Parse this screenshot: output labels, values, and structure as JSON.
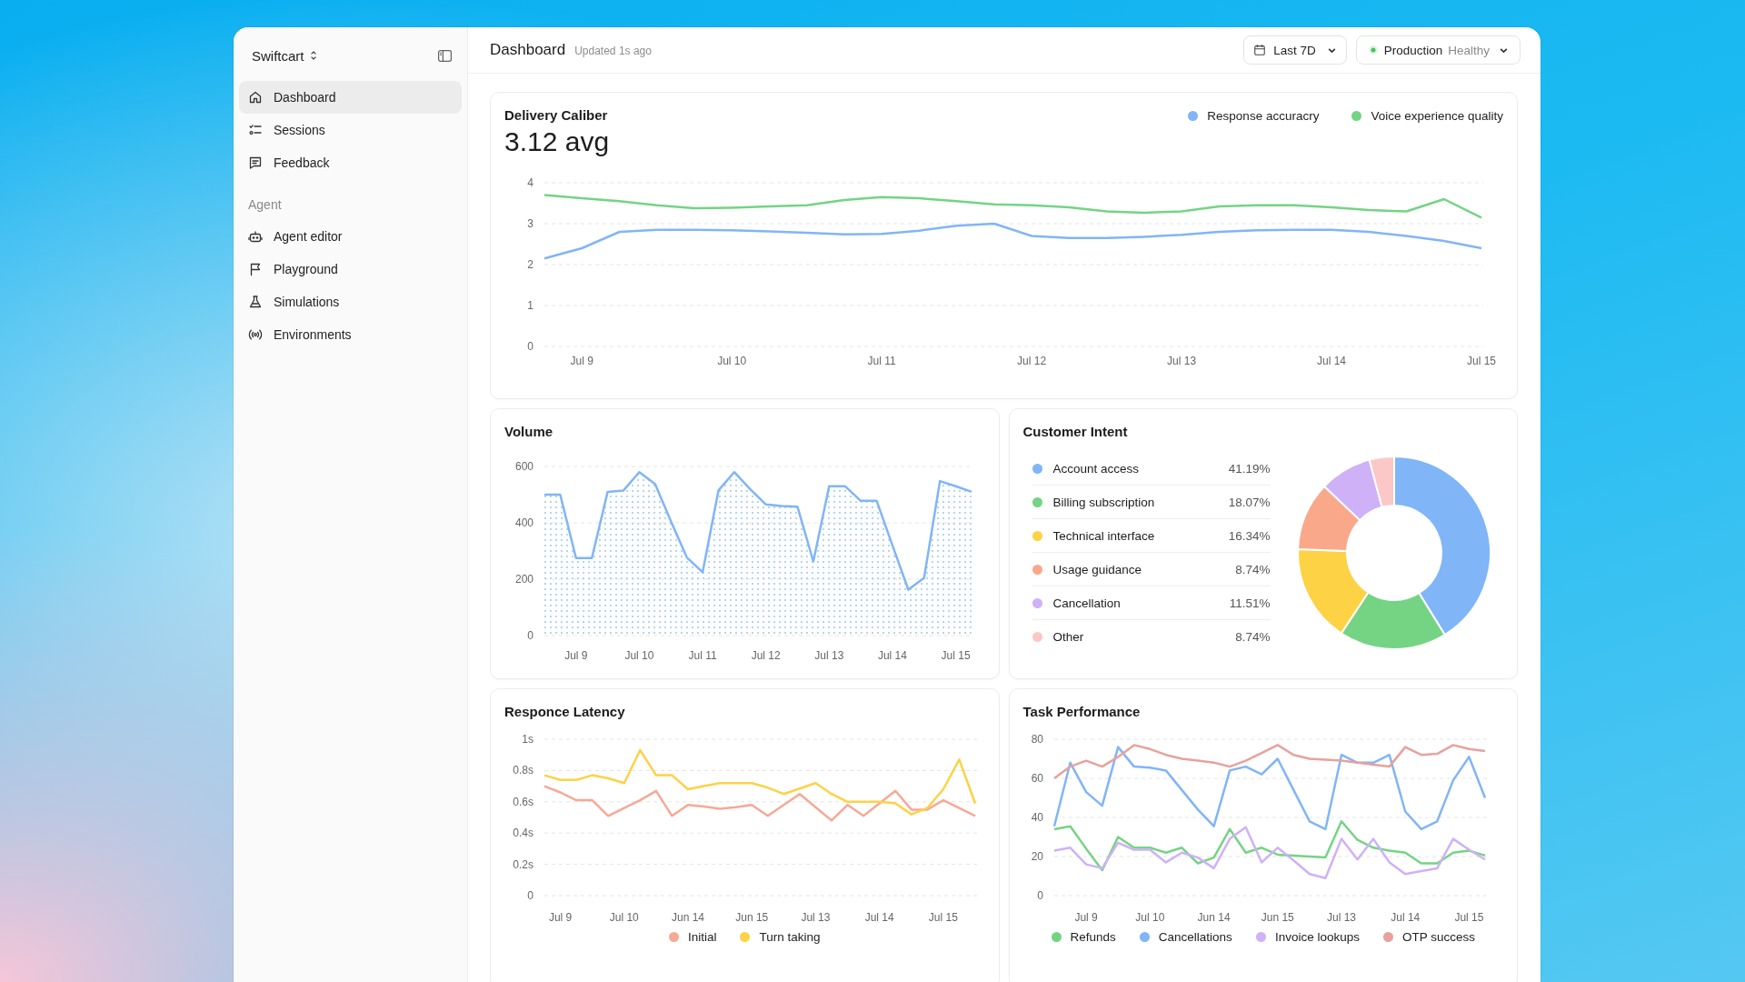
{
  "sidebar": {
    "workspace": "Swiftcart",
    "nav": [
      {
        "label": "Dashboard",
        "selected": true
      },
      {
        "label": "Sessions",
        "selected": false
      },
      {
        "label": "Feedback",
        "selected": false
      }
    ],
    "section_label": "Agent",
    "agent_nav": [
      {
        "label": "Agent editor",
        "selected": false
      },
      {
        "label": "Playground",
        "selected": false
      },
      {
        "label": "Simulations",
        "selected": false
      },
      {
        "label": "Environments",
        "selected": false
      }
    ]
  },
  "header": {
    "title": "Dashboard",
    "updated": "Updated 1s ago",
    "range": "Last 7D",
    "environment": "Production",
    "environment_status": "Healthy"
  },
  "delivery_caliber": {
    "title": "Delivery Caliber",
    "value": "3.12 avg",
    "chart_data": {
      "type": "line",
      "grid": true,
      "categories": [
        null,
        "Jul 9",
        null,
        null,
        null,
        "Jul 10",
        null,
        null,
        null,
        "Jul 11",
        null,
        null,
        null,
        "Jul 12",
        null,
        null,
        null,
        "Jul 13",
        null,
        null,
        null,
        "Jul 14",
        null,
        null,
        null,
        "Jul 15"
      ],
      "ylim": [
        0,
        4
      ],
      "yticks": [
        0,
        1,
        2,
        3,
        4
      ],
      "series": [
        {
          "name": "Response accuracry",
          "color": "#80b5f8",
          "values": [
            2.15,
            2.4,
            2.8,
            2.85,
            2.85,
            2.84,
            2.81,
            2.78,
            2.74,
            2.75,
            2.83,
            2.95,
            3.0,
            2.7,
            2.65,
            2.65,
            2.68,
            2.73,
            2.8,
            2.84,
            2.85,
            2.85,
            2.8,
            2.7,
            2.58,
            2.4
          ]
        },
        {
          "name": "Voice experience quality",
          "color": "#74d484",
          "values": [
            3.7,
            3.62,
            3.55,
            3.45,
            3.38,
            3.39,
            3.42,
            3.45,
            3.58,
            3.65,
            3.62,
            3.55,
            3.47,
            3.45,
            3.4,
            3.3,
            3.27,
            3.3,
            3.42,
            3.45,
            3.45,
            3.4,
            3.33,
            3.3,
            3.6,
            3.15
          ]
        }
      ]
    }
  },
  "volume": {
    "title": "Volume",
    "chart_data": {
      "type": "area",
      "grid": true,
      "categories": [
        null,
        null,
        "Jul 9",
        null,
        null,
        null,
        "Jul 10",
        null,
        null,
        null,
        "Jul 11",
        null,
        null,
        null,
        "Jul 12",
        null,
        null,
        null,
        "Jul 13",
        null,
        null,
        null,
        "Jul 14",
        null,
        null,
        null,
        "Jul 15",
        null
      ],
      "ylim": [
        0,
        600
      ],
      "yticks": [
        0,
        200,
        400,
        600
      ],
      "series": [
        {
          "color": "#80b5f8",
          "values": [
            500,
            500,
            275,
            275,
            510,
            515,
            580,
            537,
            405,
            277,
            225,
            515,
            580,
            520,
            465,
            460,
            457,
            263,
            530,
            530,
            478,
            478,
            320,
            163,
            205,
            548,
            530,
            510
          ]
        }
      ]
    }
  },
  "customer_intent": {
    "title": "Customer Intent",
    "items": [
      {
        "share": "41.19%",
        "color": "#80b5f8"
      },
      {
        "share": "18.07%",
        "color": "#74d484"
      },
      {
        "share": "16.34%",
        "color": "#fdd245"
      },
      {
        "share": "8.74%",
        "color": "#f9a98a"
      },
      {
        "share": "11.51%",
        "color": "#cfb1f7"
      },
      {
        "share": "8.74%",
        "color": "#fcc7c7"
      }
    ],
    "chart_data": {
      "type": "donut",
      "categories": [
        "Account access",
        "Billing subscription",
        "Technical interface",
        "Usage guidance",
        "Cancellation",
        "Other"
      ],
      "values": [
        41.19,
        18.07,
        16.34,
        11.51,
        8.74,
        4.15
      ]
    }
  },
  "response_latency": {
    "title": "Responce Latency",
    "chart_data": {
      "type": "line",
      "grid": true,
      "categories": [
        null,
        "Jul 9",
        null,
        null,
        null,
        "Jul 10",
        null,
        null,
        null,
        "Jun 14",
        null,
        null,
        null,
        "Jun 15",
        null,
        null,
        null,
        "Jul 13",
        null,
        null,
        null,
        "Jul 14",
        null,
        null,
        null,
        "Jul 15",
        null,
        null
      ],
      "ylim": [
        0,
        1
      ],
      "yticks": [
        {
          "value": 0,
          "label": "0"
        },
        {
          "value": 0.2,
          "label": "0.2s"
        },
        {
          "value": 0.4,
          "label": "0.4s"
        },
        {
          "value": 0.6,
          "label": "0.6s"
        },
        {
          "value": 0.8,
          "label": "0.8s"
        },
        {
          "value": 1,
          "label": "1s"
        }
      ],
      "series": [
        {
          "name": "Initial",
          "color": "#f6a996",
          "values": [
            0.7,
            0.66,
            0.61,
            0.61,
            0.51,
            0.56,
            0.61,
            0.67,
            0.51,
            0.58,
            0.57,
            0.555,
            0.565,
            0.58,
            0.51,
            0.58,
            0.65,
            0.565,
            0.48,
            0.58,
            0.51,
            0.59,
            0.67,
            0.55,
            0.55,
            0.61,
            0.56,
            0.51
          ]
        },
        {
          "name": "Turn taking",
          "color": "#fdd245",
          "values": [
            0.77,
            0.74,
            0.74,
            0.77,
            0.75,
            0.72,
            0.93,
            0.77,
            0.77,
            0.68,
            0.7,
            0.72,
            0.72,
            0.72,
            0.69,
            0.65,
            0.685,
            0.72,
            0.65,
            0.6,
            0.6,
            0.6,
            0.59,
            0.52,
            0.56,
            0.68,
            0.87,
            0.59
          ]
        }
      ]
    }
  },
  "task_performance": {
    "title": "Task Performance",
    "chart_data": {
      "type": "line",
      "grid": true,
      "categories": [
        null,
        null,
        "Jul 9",
        null,
        null,
        null,
        "Jul 10",
        null,
        null,
        null,
        "Jun 14",
        null,
        null,
        null,
        "Jun 15",
        null,
        null,
        null,
        "Jul 13",
        null,
        null,
        null,
        "Jul 14",
        null,
        null,
        null,
        "Jul 15",
        null
      ],
      "ylim": [
        0,
        80
      ],
      "yticks": [
        0,
        20,
        40,
        60,
        80
      ],
      "series": [
        {
          "name": "Refunds",
          "color": "#74d484",
          "values": [
            34,
            35.5,
            24,
            13,
            30,
            24.5,
            24.5,
            22,
            24.5,
            16.5,
            19.5,
            34,
            22,
            24.5,
            21,
            20.5,
            20,
            19.5,
            38,
            28.5,
            24.5,
            23,
            22,
            16.5,
            16.5,
            22,
            23,
            20.5
          ]
        },
        {
          "name": "Cancellations",
          "color": "#80b5f8",
          "values": [
            35.5,
            68,
            53,
            46,
            76,
            66,
            65.5,
            64,
            54,
            44,
            35.5,
            64,
            66,
            62,
            70,
            54,
            38,
            34,
            72,
            68,
            68,
            72,
            43,
            34,
            38,
            59,
            71,
            50
          ]
        },
        {
          "name": "Invoice lookups",
          "color": "#cfb1f7",
          "values": [
            23,
            24.5,
            16,
            14,
            27,
            23.5,
            23.5,
            17,
            22,
            19.5,
            14,
            29,
            35,
            17,
            24.5,
            18,
            11,
            9,
            29,
            18.5,
            29,
            17,
            11,
            12.5,
            14,
            29,
            23.5,
            18.5
          ]
        },
        {
          "name": "OTP success",
          "color": "#e8a19d",
          "values": [
            60,
            66,
            69,
            66,
            71,
            77,
            75,
            72,
            70,
            69,
            68,
            66,
            69,
            73,
            77,
            72,
            70,
            69.5,
            69,
            68,
            67,
            66,
            76,
            72,
            72.5,
            77,
            75,
            74
          ]
        }
      ]
    }
  }
}
